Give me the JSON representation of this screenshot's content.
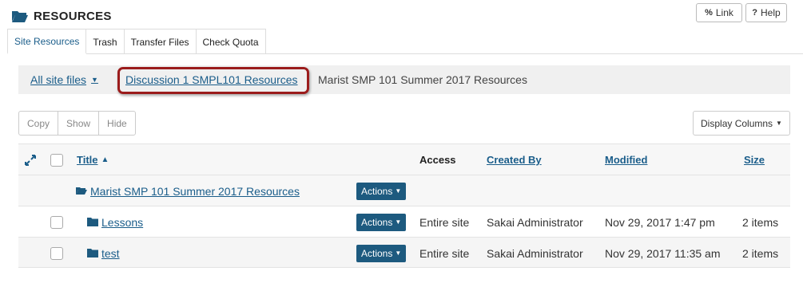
{
  "header": {
    "title": "RESOURCES",
    "link_label": "Link",
    "help_label": "Help"
  },
  "tabs": [
    {
      "label": "Site Resources",
      "active": true
    },
    {
      "label": "Trash"
    },
    {
      "label": "Transfer Files"
    },
    {
      "label": "Check Quota"
    }
  ],
  "breadcrumb": {
    "all_label": "All site files",
    "parent_label": "Discussion 1 SMPL101 Resources",
    "current_label": "Marist SMP 101 Summer 2017 Resources"
  },
  "toolbar": {
    "copy_label": "Copy",
    "show_label": "Show",
    "hide_label": "Hide",
    "display_columns_label": "Display Columns"
  },
  "table": {
    "headers": {
      "title": "Title",
      "access": "Access",
      "created_by": "Created By",
      "modified": "Modified",
      "size": "Size"
    },
    "parent_row": {
      "title": "Marist SMP 101 Summer 2017 Resources",
      "actions_label": "Actions"
    },
    "rows": [
      {
        "title": "Lessons",
        "actions_label": "Actions",
        "access": "Entire site",
        "created_by": "Sakai Administrator",
        "modified": "Nov 29, 2017 1:47 pm",
        "size": "2 items"
      },
      {
        "title": "test",
        "actions_label": "Actions",
        "access": "Entire site",
        "created_by": "Sakai Administrator",
        "modified": "Nov 29, 2017 11:35 am",
        "size": "2 items"
      }
    ]
  },
  "colors": {
    "accent": "#1a5d8a",
    "actions_bg": "#1d5a7f",
    "highlight": "#9b1c1c"
  }
}
